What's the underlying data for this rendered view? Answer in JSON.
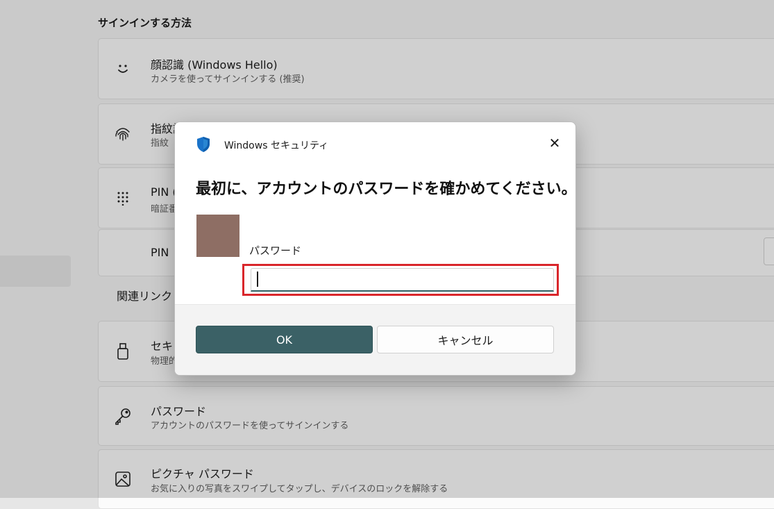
{
  "settings": {
    "section_title": "サインインする方法",
    "cards": [
      {
        "icon": "smiley-face-icon",
        "title": "顔認識 (Windows Hello)",
        "subtitle": "カメラを使ってサインインする (推奨)"
      },
      {
        "icon": "fingerprint-icon",
        "title": "指紋認",
        "subtitle": "指紋"
      },
      {
        "icon": "pin-keypad-icon",
        "title": "PIN (",
        "subtitle": "暗証番"
      },
      {
        "icon": "",
        "title": "PIN",
        "subtitle": ""
      },
      {
        "icon": "usb-key-icon",
        "title": "セキュ",
        "subtitle": "物理的"
      },
      {
        "icon": "key-icon",
        "title": "パスワード",
        "subtitle": "アカウントのパスワードを使ってサインインする"
      },
      {
        "icon": "picture-icon",
        "title": "ピクチャ パスワード",
        "subtitle": "お気に入りの写真をスワイプしてタップし、デバイスのロックを解除する"
      }
    ],
    "related_label": "関連リンク"
  },
  "dialog": {
    "title": "Windows セキュリティ",
    "heading": "最初に、アカウントのパスワードを確かめてください。",
    "password_label": "パスワード",
    "password_value": "",
    "ok_label": "OK",
    "cancel_label": "キャンセル",
    "close_glyph": "✕",
    "accent_color": "#3b6166",
    "highlight_color": "#d9262b"
  }
}
